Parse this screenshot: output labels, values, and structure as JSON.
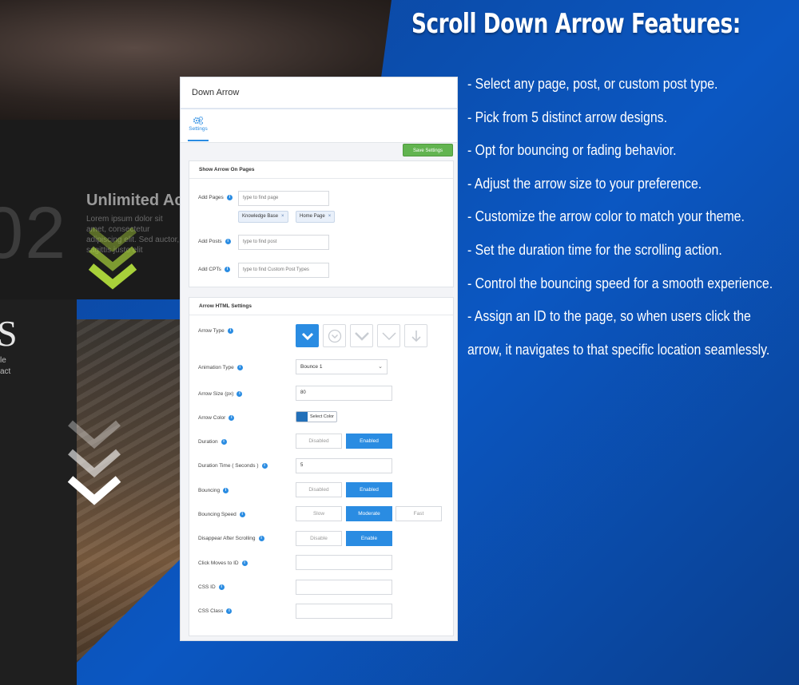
{
  "heading": "Scroll Down Arrow Features:",
  "features": [
    "- Select any page, post, or custom post type.",
    "- Pick from 5 distinct arrow designs.",
    "- Opt for bouncing or fading behavior.",
    "- Adjust the arrow size to your preference.",
    "- Customize the arrow color to match your theme.",
    "- Set the duration time for the scrolling action.",
    "- Control the bouncing speed for a smooth experience.",
    "- Assign an ID to the page, so when users click the",
    "arrow, it navigates to that specific location seamlessly."
  ],
  "background": {
    "big_number": "02",
    "card_title": "Unlimited Acc",
    "card_lorem": "Lorem ipsum dolor sit amet, consectetur adipiscing elit. Sed auctor, sagittis justo elit",
    "letter": "S",
    "strip_lines": [
      "le",
      "act"
    ]
  },
  "panel": {
    "title": "Down Arrow",
    "tab_label": "Settings",
    "save_label": "Save Settings",
    "pages_section": {
      "title": "Show Arrow On Pages",
      "add_pages_label": "Add Pages",
      "add_pages_placeholder": "type to find page",
      "chips": [
        "Knowledge Base",
        "Home Page"
      ],
      "add_posts_label": "Add Posts",
      "add_posts_placeholder": "type to find post",
      "add_cpts_label": "Add CPTs",
      "add_cpts_placeholder": "type to find Custom Post Types"
    },
    "html_section": {
      "title": "Arrow HTML Settings",
      "arrow_type_label": "Arrow Type",
      "arrow_types": [
        "chevron-bold",
        "chevron-circle",
        "chevron-wide",
        "chevron-thin",
        "arrow-down"
      ],
      "selected_arrow": 0,
      "animation_type_label": "Animation Type",
      "animation_type_value": "Bounce 1",
      "arrow_size_label": "Arrow Size (px)",
      "arrow_size_value": "80",
      "arrow_color_label": "Arrow Color",
      "arrow_color_value": "#2270b9",
      "select_color_label": "Select Color",
      "duration_label": "Duration",
      "duration_options": [
        "Disabled",
        "Enabled"
      ],
      "duration_selected": "Enabled",
      "duration_time_label": "Duration Time ( Seconds )",
      "duration_time_value": "5",
      "bouncing_label": "Bouncing",
      "bouncing_options": [
        "Disabled",
        "Enabled"
      ],
      "bouncing_selected": "Enabled",
      "bouncing_speed_label": "Bouncing Speed",
      "bouncing_speed_options": [
        "Slow",
        "Moderate",
        "Fast"
      ],
      "bouncing_speed_selected": "Moderate",
      "disappear_label": "Disappear After Scrolling",
      "disappear_options": [
        "Disable",
        "Enable"
      ],
      "disappear_selected": "Enable",
      "click_moves_label": "Click Moves to ID",
      "click_moves_value": "",
      "css_id_label": "CSS ID",
      "css_id_value": "",
      "css_class_label": "CSS Class",
      "css_class_value": ""
    }
  },
  "colors": {
    "accent": "#2a8ce2",
    "save_green": "#62b450",
    "chevron_green": "#a8d13a",
    "background_blue": "#0b4fb0"
  }
}
